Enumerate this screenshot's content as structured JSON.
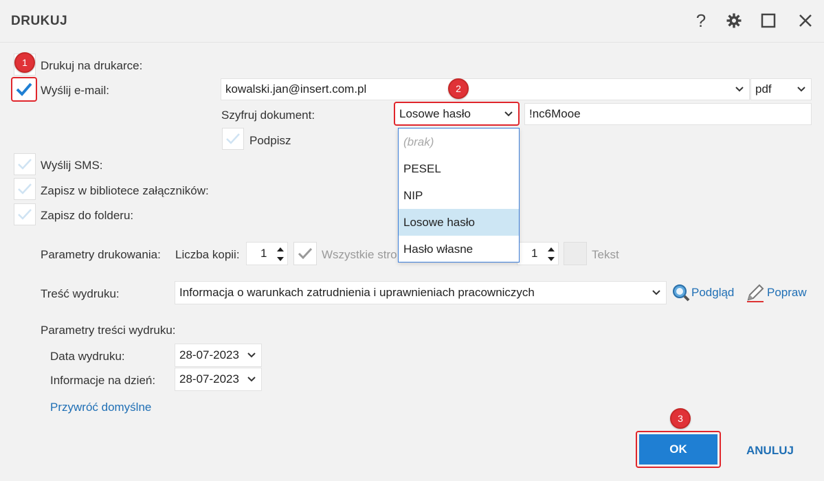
{
  "window": {
    "title": "DRUKUJ",
    "help_label": "?"
  },
  "options": {
    "print_label": "Drukuj na drukarce:",
    "email_label": "Wyślij e-mail:",
    "email_value": "kowalski.jan@insert.com.pl",
    "format_value": "pdf",
    "encrypt_label": "Szyfruj dokument:",
    "encrypt_value": "Losowe hasło",
    "password_value": "!nc6Mooe",
    "sign_label": "Podpisz",
    "sms_label": "Wyślij SMS:",
    "library_label": "Zapisz w bibliotece załączników:",
    "folder_label": "Zapisz do folderu:"
  },
  "encrypt_dropdown": {
    "items": [
      "(brak)",
      "PESEL",
      "NIP",
      "Losowe hasło",
      "Hasło własne"
    ],
    "selected": "Losowe hasło"
  },
  "print_params": {
    "label": "Parametry drukowania:",
    "copies_label": "Liczba kopii:",
    "copies_value": "1",
    "all_pages_label": "Wszystkie stro",
    "second_value": "1",
    "text_label": "Tekst"
  },
  "content": {
    "label": "Treść wydruku:",
    "value": "Informacja o warunkach zatrudnienia i uprawnieniach pracowniczych",
    "preview_label": "Podgląd",
    "fix_label": "Popraw"
  },
  "content_params": {
    "label": "Parametry treści wydruku:",
    "print_date_label": "Data wydruku:",
    "print_date_value": "28-07-2023",
    "info_date_label": "Informacje na dzień:",
    "info_date_value": "28-07-2023",
    "restore_label": "Przywróć domyślne"
  },
  "buttons": {
    "ok": "OK",
    "cancel": "ANULUJ"
  },
  "badges": [
    "1",
    "2",
    "3"
  ],
  "colors": {
    "accent": "#1f7fd3",
    "badge": "#e03237",
    "link": "#1f6fb5"
  }
}
